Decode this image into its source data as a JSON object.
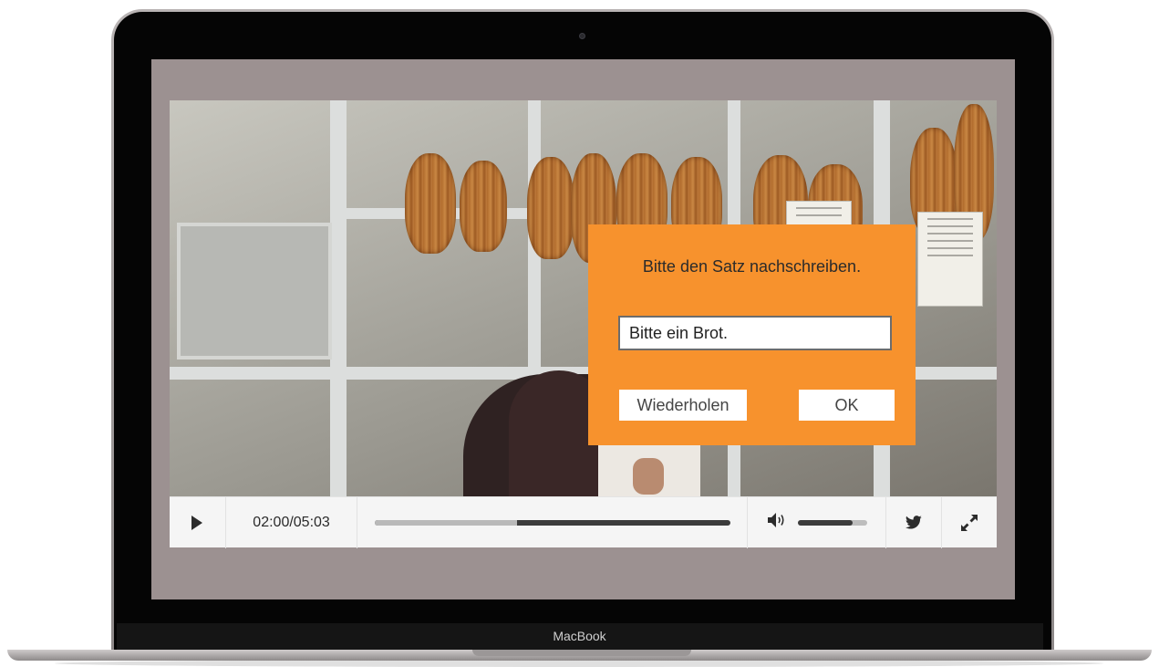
{
  "device": {
    "label": "MacBook"
  },
  "dialog": {
    "title": "Bitte den Satz nachschreiben.",
    "input_value": "Bitte ein Brot.",
    "repeat_label": "Wiederholen",
    "ok_label": "OK",
    "background_color": "#f7922d"
  },
  "player": {
    "time_display": "02:00/05:03",
    "progress_fraction": 0.4,
    "volume_fraction": 0.8,
    "icons": {
      "play": "play-icon",
      "volume": "volume-icon",
      "share": "twitter-icon",
      "fullscreen": "fullscreen-icon"
    }
  },
  "colors": {
    "screen_background": "#9c9191",
    "controls_background": "#f5f5f5"
  }
}
